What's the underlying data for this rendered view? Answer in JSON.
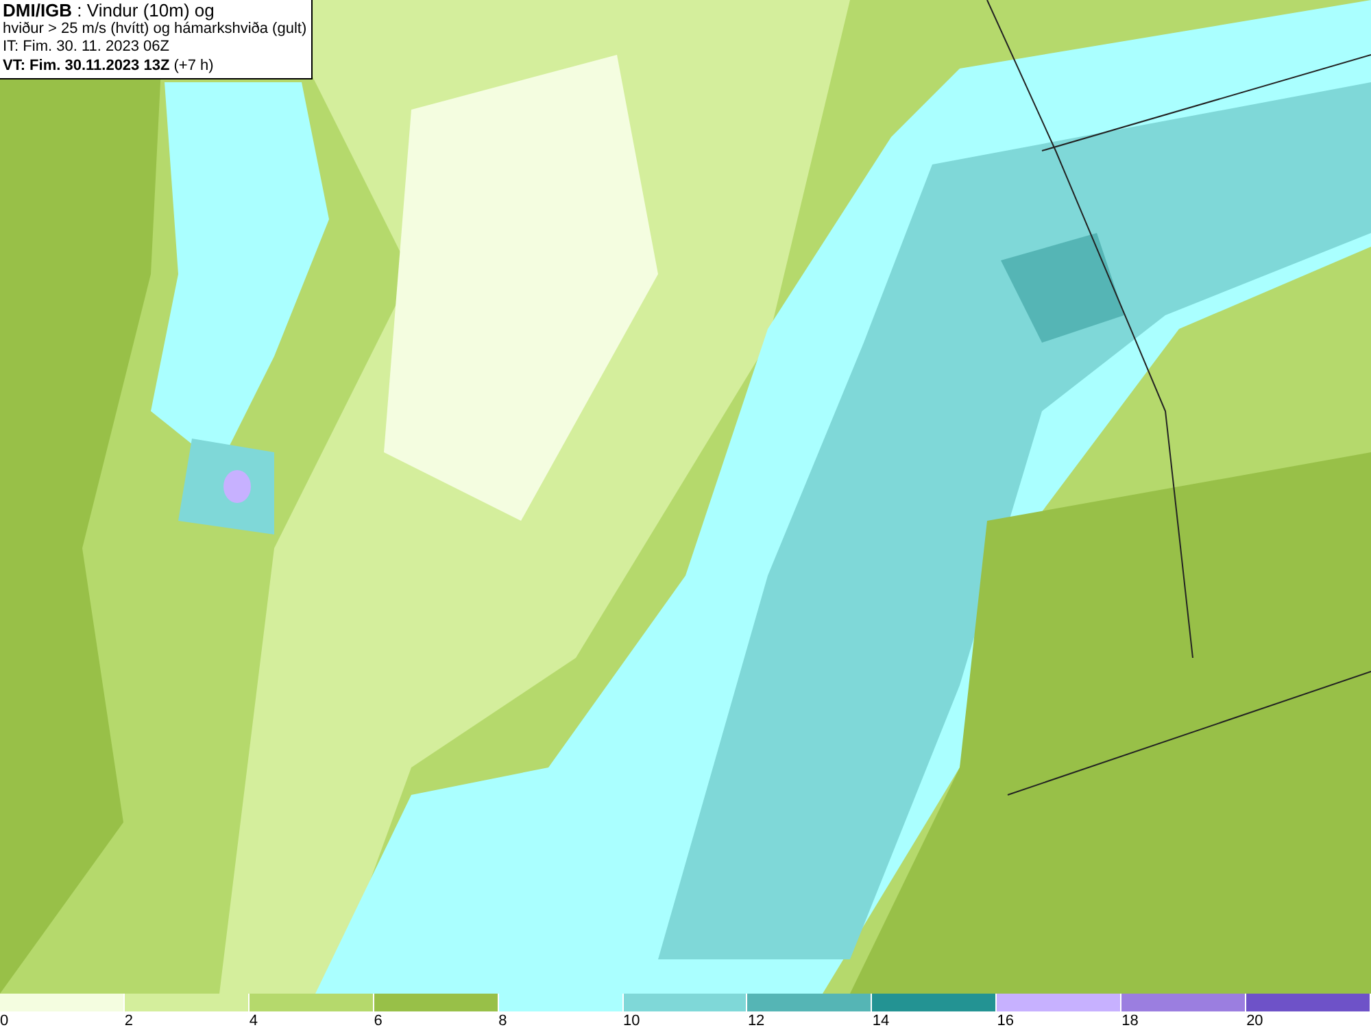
{
  "header": {
    "lines": [
      "**DMI/IGB** : Vindur (10m) og",
      "hviður > 25 m/s (hvítt) og hámarkshviða (gult)",
      "IT: Fim. 30. 11. 2023 06Z",
      "**VT: Fim. 30.11.2023 13Z** (+7 h)"
    ]
  },
  "legend": {
    "swatches": [
      {
        "color": "#f4fde0",
        "label": "0"
      },
      {
        "color": "#d4ee9c",
        "label": "2"
      },
      {
        "color": "#b5d96c",
        "label": "4"
      },
      {
        "color": "#98c048",
        "label": "6"
      },
      {
        "color": "#aaffff",
        "label": "8"
      },
      {
        "color": "#7fd8d8",
        "label": "10"
      },
      {
        "color": "#55b5b5",
        "label": "12"
      },
      {
        "color": "#239393",
        "label": "14"
      },
      {
        "color": "#c7b1ff",
        "label": "16"
      },
      {
        "color": "#9b7ee0",
        "label": "18"
      },
      {
        "color": "#6e52c8",
        "label": "20"
      }
    ]
  }
}
